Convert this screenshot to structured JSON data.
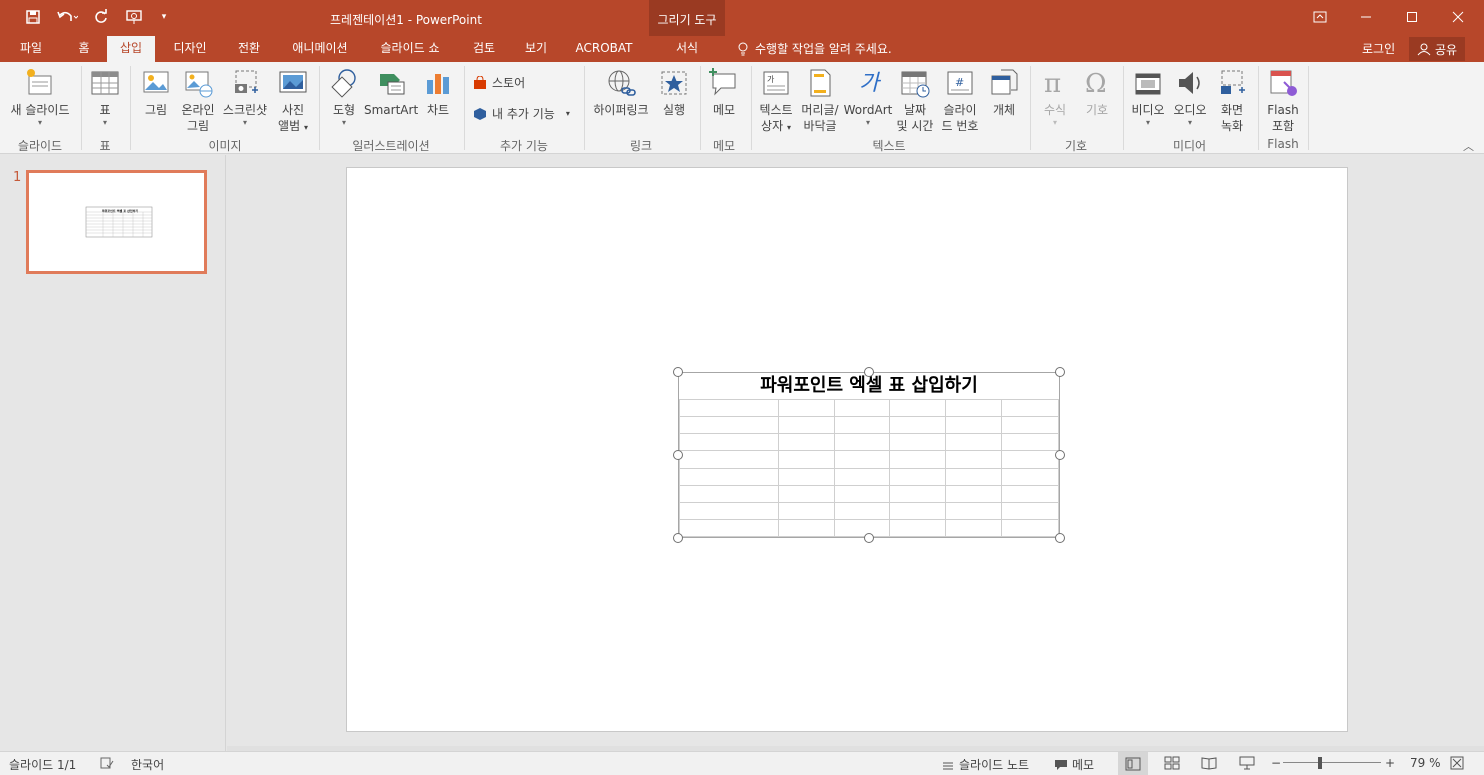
{
  "window": {
    "title": "프레젠테이션1 - PowerPoint",
    "contextual_tab_group": "그리기 도구",
    "colors": {
      "accent": "#b7472a",
      "accent_dark": "#9a3a22",
      "ribbon_bg": "#f3f3f3",
      "thumb_border": "#e07b5a"
    }
  },
  "qat": {
    "icons": [
      "save-icon",
      "undo-icon",
      "redo-icon",
      "present-icon",
      "customize-icon"
    ]
  },
  "tabs": [
    {
      "label": "파일"
    },
    {
      "label": "홈"
    },
    {
      "label": "삽입"
    },
    {
      "label": "디자인"
    },
    {
      "label": "전환"
    },
    {
      "label": "애니메이션"
    },
    {
      "label": "슬라이드 쇼"
    },
    {
      "label": "검토"
    },
    {
      "label": "보기"
    },
    {
      "label": "ACROBAT"
    },
    {
      "label": "서식"
    }
  ],
  "tell_me": "수행할 작업을 알려 주세요.",
  "account": {
    "login": "로그인",
    "share": "공유"
  },
  "ribbon": {
    "new_slide_1": "새 슬라이드",
    "table": "표",
    "picture": "그림",
    "online_picture_1": "온라인",
    "online_picture_2": "그림",
    "screenshot": "스크린샷",
    "photo_album_1": "사진",
    "photo_album_2": "앨범",
    "shapes": "도형",
    "smartart": "SmartArt",
    "chart": "차트",
    "store": "스토어",
    "my_addins": "내 추가 기능",
    "hyperlink": "하이퍼링크",
    "action": "실행",
    "comment": "메모",
    "textbox_1": "텍스트",
    "textbox_2": "상자",
    "header_1": "머리글/",
    "header_2": "바닥글",
    "wordart": "WordArt",
    "datetime_1": "날짜",
    "datetime_2": "및 시간",
    "slidenum_1": "슬라이",
    "slidenum_2": "드 번호",
    "object": "개체",
    "equation": "수식",
    "symbol": "기호",
    "video": "비디오",
    "audio": "오디오",
    "screenrec_1": "화면",
    "screenrec_2": "녹화",
    "flash_1": "Flash",
    "flash_2": "포함",
    "groups": {
      "slides": "슬라이드",
      "tables": "표",
      "images": "이미지",
      "illustrations": "일러스트레이션",
      "addins": "추가 기능",
      "links": "링크",
      "comments": "메모",
      "text": "텍스트",
      "symbols": "기호",
      "media": "미디어",
      "flash": "Flash"
    }
  },
  "slides_panel": {
    "slide_number": "1",
    "thumb_title": "파워포인트 엑셀 표 삽입하기"
  },
  "slide": {
    "table_title": "파워포인트 엑셀 표 삽입하기",
    "table_rows": 8,
    "table_cols": 6
  },
  "status": {
    "slide_count": "슬라이드 1/1",
    "language": "한국어",
    "notes": "슬라이드 노트",
    "comments": "메모",
    "zoom": "79 %"
  }
}
